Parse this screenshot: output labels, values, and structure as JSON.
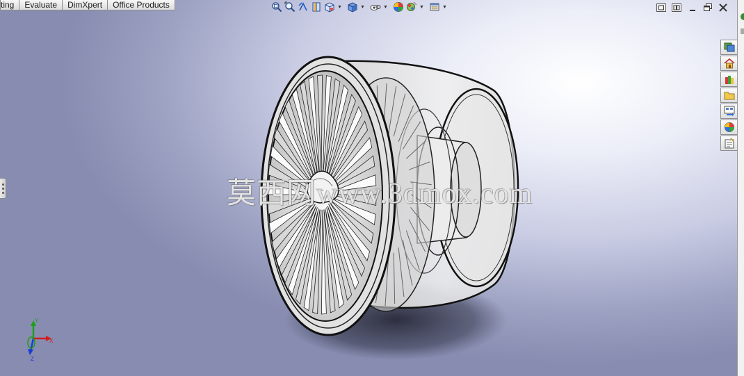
{
  "command_tabs": [
    "ting",
    "Evaluate",
    "DimXpert",
    "Office Products"
  ],
  "view_toolbar": {
    "buttons": [
      "zoom-to-fit-icon",
      "zoom-to-area-icon",
      "previous-view-icon",
      "section-view-icon",
      "view-orientation-icon",
      "display-style-icon",
      "hide-show-items-icon",
      "edit-appearance-icon",
      "apply-scene-icon",
      "view-settings-icon"
    ]
  },
  "window_controls": {
    "model_window": [
      "restore-icon",
      "tile-icon"
    ],
    "app_window": [
      "minimize-icon",
      "restore-icon",
      "close-icon"
    ]
  },
  "task_pane": [
    "solidworks-resources-icon",
    "home-icon",
    "design-library-icon",
    "file-explorer-icon",
    "view-palette-icon",
    "appearances-icon",
    "custom-properties-icon"
  ],
  "watermark": "莫西网www.3dmox.com",
  "triad": {
    "x": "X",
    "y": "Y",
    "z": "Z"
  },
  "colors": {
    "x_axis": "#d21e1e",
    "y_axis": "#1aa01a",
    "z_axis": "#1a3ad2"
  }
}
